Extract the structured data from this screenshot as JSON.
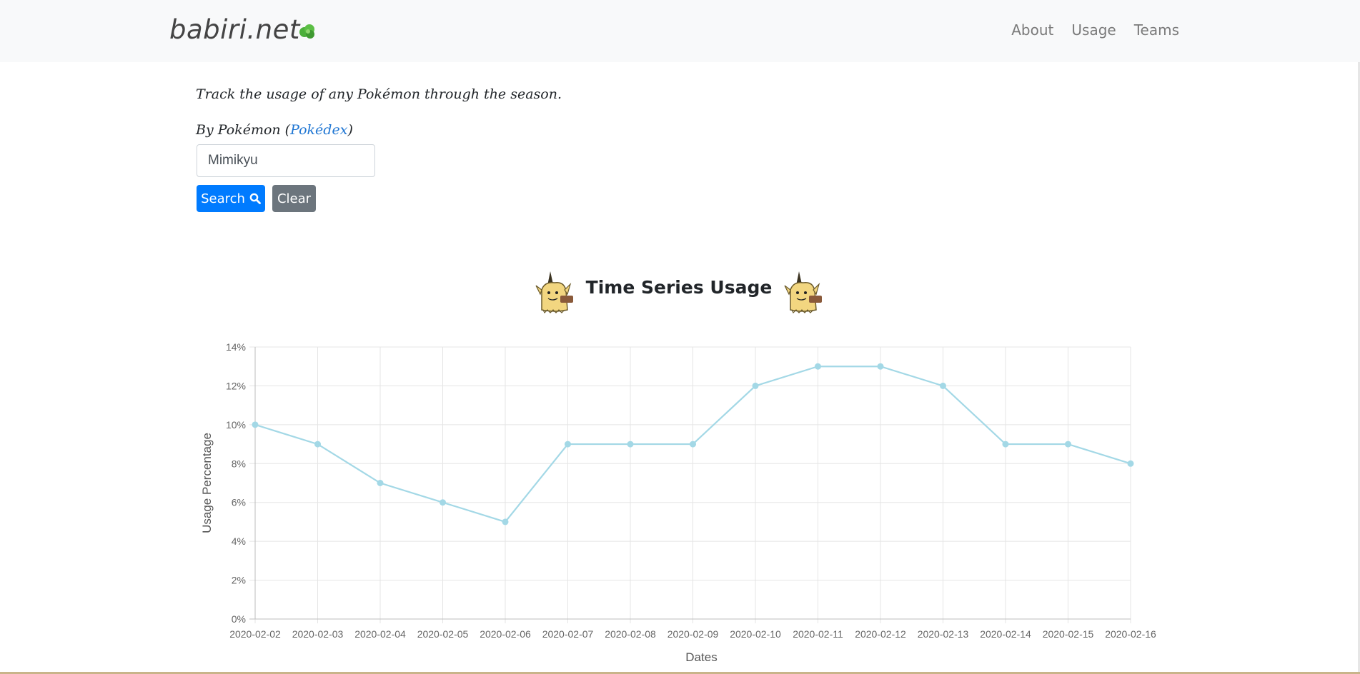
{
  "header": {
    "brand": "babiri.net",
    "brand_icon": "green-leaf-icon",
    "nav": [
      {
        "label": "About"
      },
      {
        "label": "Usage"
      },
      {
        "label": "Teams"
      }
    ]
  },
  "main": {
    "intro": "Track the usage of any Pokémon through the season.",
    "by_label": "By Pokémon",
    "pokedex_link": "Pokédex",
    "search_value": "Mimikyu",
    "search_button": "Search",
    "clear_button": "Clear",
    "chart_title": "Time Series Usage",
    "sprite_icon": "mimikyu-sprite-icon"
  },
  "colors": {
    "primary": "#007bff",
    "secondary": "#6c757d",
    "series": "#a3d8e6",
    "link": "#1f76d3"
  },
  "chart_data": {
    "type": "line",
    "x": [
      "2020-02-02",
      "2020-02-03",
      "2020-02-04",
      "2020-02-05",
      "2020-02-06",
      "2020-02-07",
      "2020-02-08",
      "2020-02-09",
      "2020-02-10",
      "2020-02-11",
      "2020-02-12",
      "2020-02-13",
      "2020-02-14",
      "2020-02-15",
      "2020-02-16"
    ],
    "series": [
      {
        "values": [
          10,
          9,
          7,
          6,
          5,
          9,
          9,
          9,
          12,
          13,
          13,
          12,
          9,
          9,
          8
        ]
      }
    ],
    "xlabel": "Dates",
    "ylabel": "Usage Percentage",
    "ylim": [
      0,
      14
    ],
    "yticks": [
      "0%",
      "2%",
      "4%",
      "6%",
      "8%",
      "10%",
      "12%",
      "14%"
    ],
    "grid": true
  }
}
